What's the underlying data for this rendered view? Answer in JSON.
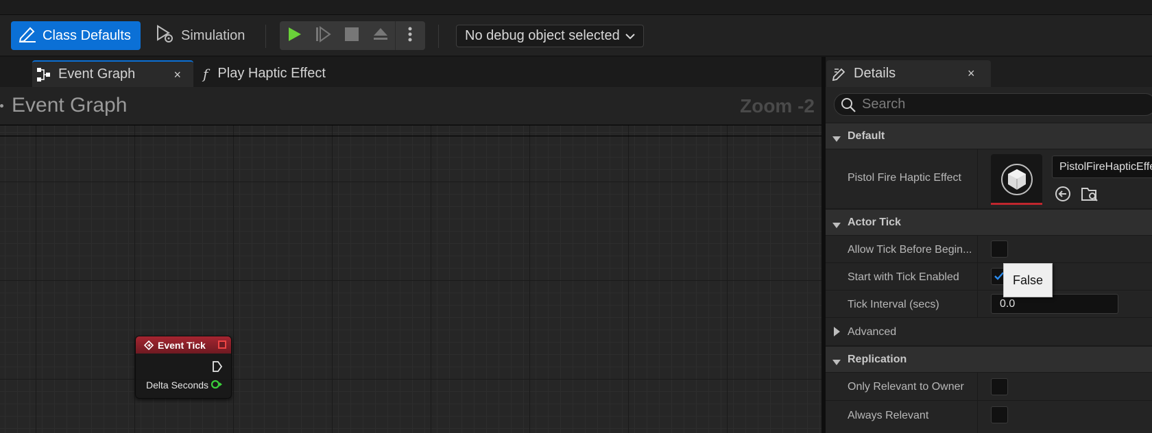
{
  "toolbar": {
    "class_defaults_label": "Class Defaults",
    "simulation_label": "Simulation",
    "debug_select_value": "No debug object selected"
  },
  "tabs": [
    {
      "label": "Event Graph",
      "close": "×"
    },
    {
      "label": "Play Haptic Effect"
    }
  ],
  "graph": {
    "title": "Event Graph",
    "zoom": "Zoom -2",
    "node": {
      "title": "Event Tick",
      "pin_label": "Delta Seconds"
    }
  },
  "details": {
    "tab_label": "Details",
    "close": "×",
    "search_placeholder": "Search",
    "categories": {
      "default": "Default",
      "actor_tick": "Actor Tick",
      "advanced": "Advanced",
      "replication": "Replication"
    },
    "properties": {
      "pistol_fire_haptic_effect": {
        "label": "Pistol Fire Haptic Effect",
        "value": "PistolFireHapticEffect"
      },
      "allow_tick_before_begin": {
        "label": "Allow Tick Before Begin...",
        "checked": false
      },
      "start_with_tick_enabled": {
        "label": "Start with Tick Enabled",
        "checked": true
      },
      "tick_interval": {
        "label": "Tick Interval (secs)",
        "value": "0.0"
      },
      "only_relevant_to_owner": {
        "label": "Only Relevant to Owner",
        "checked": false
      },
      "always_relevant": {
        "label": "Always Relevant",
        "checked": false
      }
    },
    "tooltip": "False"
  },
  "colors": {
    "accent": "#0b70d6",
    "play_green": "#6ad139",
    "event_node_red": "#a52530",
    "float_pin_green": "#3bd13b"
  }
}
